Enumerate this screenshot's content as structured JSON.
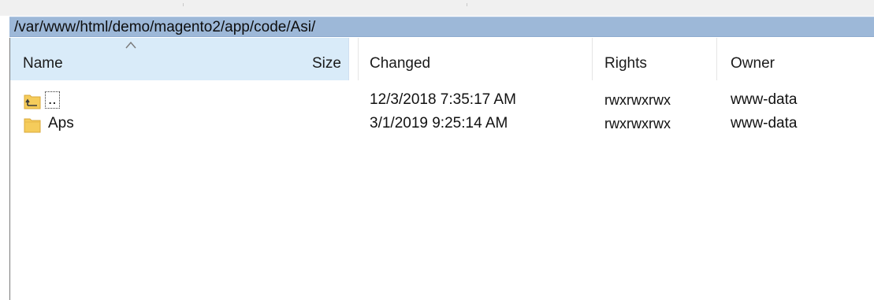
{
  "path_bar": {
    "path": "/var/www/html/demo/magento2/app/code/Asi/"
  },
  "columns": {
    "name": "Name",
    "size": "Size",
    "changed": "Changed",
    "rights": "Rights",
    "owner": "Owner"
  },
  "rows": [
    {
      "icon": "parent-directory-icon",
      "name": "..",
      "size": "",
      "changed": "12/3/2018 7:35:17 AM",
      "rights": "rwxrwxrwx",
      "owner": "www-data"
    },
    {
      "icon": "folder-icon",
      "name": "Aps",
      "size": "",
      "changed": "3/1/2019 9:25:14 AM",
      "rights": "rwxrwxrwx",
      "owner": "www-data"
    }
  ],
  "colors": {
    "path_bar_bg": "#9db8d8",
    "sorted_header_bg": "#d9ebf9",
    "folder_yellow": "#f5cc5b"
  }
}
